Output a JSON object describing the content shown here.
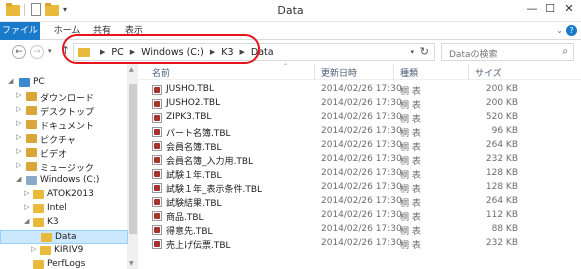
{
  "window": {
    "title": "Data",
    "minimize": "—",
    "maximize": "☐",
    "close": "✕"
  },
  "ribbon": {
    "tabs": [
      "ファイル",
      "ホーム",
      "共有",
      "表示"
    ],
    "help": "?"
  },
  "address": {
    "crumbs": [
      "PC",
      "Windows (C:)",
      "K3",
      "Data"
    ],
    "search_placeholder": "Dataの検索"
  },
  "nav_tree": [
    {
      "label": "PC",
      "icon": "pc-icon",
      "expanded": true
    },
    {
      "label": "ダウンロード",
      "icon": "folder-icon"
    },
    {
      "label": "デスクトップ",
      "icon": "folder-icon"
    },
    {
      "label": "ドキュメント",
      "icon": "folder-icon"
    },
    {
      "label": "ピクチャ",
      "icon": "folder-icon"
    },
    {
      "label": "ビデオ",
      "icon": "folder-icon"
    },
    {
      "label": "ミュージック",
      "icon": "folder-icon"
    },
    {
      "label": "Windows (C:)",
      "icon": "drive-icon",
      "expanded": true
    },
    {
      "label": "ATOK2013",
      "icon": "folder-icon"
    },
    {
      "label": "Intel",
      "icon": "folder-icon"
    },
    {
      "label": "K3",
      "icon": "folder-icon",
      "expanded": true
    },
    {
      "label": "Data",
      "icon": "folder-icon",
      "selected": true
    },
    {
      "label": "KIRIV9",
      "icon": "folder-icon"
    },
    {
      "label": "PerfLogs",
      "icon": "folder-icon"
    }
  ],
  "columns": {
    "name": "名前",
    "date": "更新日時",
    "type": "種類",
    "size": "サイズ"
  },
  "files": [
    {
      "name": "JUSHO.TBL",
      "date": "2014/02/26 17:30",
      "type": "桐 表",
      "size": "200 KB"
    },
    {
      "name": "JUSHO2.TBL",
      "date": "2014/02/26 17:30",
      "type": "桐 表",
      "size": "200 KB"
    },
    {
      "name": "ZIPK3.TBL",
      "date": "2014/02/26 17:30",
      "type": "桐 表",
      "size": "520 KB"
    },
    {
      "name": "パート名簿.TBL",
      "date": "2014/02/26 17:30",
      "type": "桐 表",
      "size": "96 KB"
    },
    {
      "name": "会員名簿.TBL",
      "date": "2014/02/26 17:30",
      "type": "桐 表",
      "size": "264 KB"
    },
    {
      "name": "会員名簿_入力用.TBL",
      "date": "2014/02/26 17:30",
      "type": "桐 表",
      "size": "232 KB"
    },
    {
      "name": "試験１年.TBL",
      "date": "2014/02/26 17:30",
      "type": "桐 表",
      "size": "128 KB"
    },
    {
      "name": "試験１年_表示条件.TBL",
      "date": "2014/02/26 17:30",
      "type": "桐 表",
      "size": "128 KB"
    },
    {
      "name": "試験結果.TBL",
      "date": "2014/02/26 17:30",
      "type": "桐 表",
      "size": "264 KB"
    },
    {
      "name": "商品.TBL",
      "date": "2014/02/26 17:30",
      "type": "桐 表",
      "size": "112 KB"
    },
    {
      "name": "得意先.TBL",
      "date": "2014/02/26 17:30",
      "type": "桐 表",
      "size": "88 KB"
    },
    {
      "name": "売上げ伝票.TBL",
      "date": "2014/02/26 17:30",
      "type": "桐 表",
      "size": "232 KB"
    }
  ]
}
